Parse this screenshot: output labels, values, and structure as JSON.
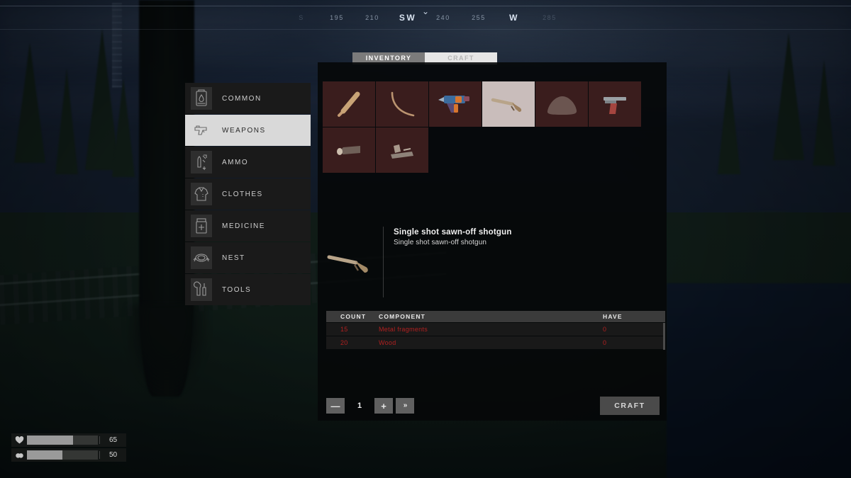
{
  "compass": {
    "ticks": [
      {
        "label": "S",
        "type": "faded"
      },
      {
        "label": "195",
        "type": "num"
      },
      {
        "label": "210",
        "type": "num"
      },
      {
        "label": "SW",
        "type": "cardinal"
      },
      {
        "label": "240",
        "type": "num"
      },
      {
        "label": "255",
        "type": "num"
      },
      {
        "label": "W",
        "type": "cardinal"
      },
      {
        "label": "285",
        "type": "faded"
      }
    ],
    "marker": "⌄"
  },
  "tabs": [
    {
      "label": "INVENTORY",
      "active": false,
      "name": "tab-inventory"
    },
    {
      "label": "CRAFT",
      "active": true,
      "name": "tab-craft"
    }
  ],
  "sidebar": {
    "items": [
      {
        "label": "COMMON",
        "icon": "backpack-icon",
        "active": false
      },
      {
        "label": "WEAPONS",
        "icon": "pistol-icon",
        "active": true
      },
      {
        "label": "AMMO",
        "icon": "ammo-icon",
        "active": false
      },
      {
        "label": "CLOTHES",
        "icon": "shirt-icon",
        "active": false
      },
      {
        "label": "MEDICINE",
        "icon": "pillbottle-icon",
        "active": false
      },
      {
        "label": "NEST",
        "icon": "nest-icon",
        "active": false
      },
      {
        "label": "TOOLS",
        "icon": "tools-icon",
        "active": false
      }
    ]
  },
  "grid": {
    "items": [
      {
        "name": "baseball-bat",
        "icon": "bat",
        "selected": false
      },
      {
        "name": "bow",
        "icon": "bow",
        "selected": false
      },
      {
        "name": "nail-gun",
        "icon": "nailgun",
        "selected": false
      },
      {
        "name": "sawn-off-shotgun",
        "icon": "shotgun",
        "selected": true
      },
      {
        "name": "stone",
        "icon": "stone",
        "selected": false
      },
      {
        "name": "pistol",
        "icon": "pistol",
        "selected": false
      },
      {
        "name": "flashlight",
        "icon": "flashlight",
        "selected": false
      },
      {
        "name": "gun-part",
        "icon": "gunpart",
        "selected": false
      }
    ]
  },
  "detail": {
    "title": "Single shot sawn-off shotgun",
    "description": "Single shot sawn-off shotgun"
  },
  "components": {
    "headers": {
      "count": "COUNT",
      "component": "COMPONENT",
      "have": "HAVE"
    },
    "rows": [
      {
        "count": "15",
        "component": "Metal fragments",
        "have": "0",
        "insufficient": true
      },
      {
        "count": "20",
        "component": "Wood",
        "have": "0",
        "insufficient": true
      }
    ],
    "insufficient_color": "#b02020"
  },
  "footer": {
    "decrease_label": "—",
    "quantity": "1",
    "increase_label": "+",
    "max_label": "»",
    "craft_label": "CRAFT"
  },
  "hud": {
    "health": {
      "icon": "heart-icon",
      "value": "65",
      "percent": 65
    },
    "hunger": {
      "icon": "food-icon",
      "value": "50",
      "percent": 50
    }
  }
}
